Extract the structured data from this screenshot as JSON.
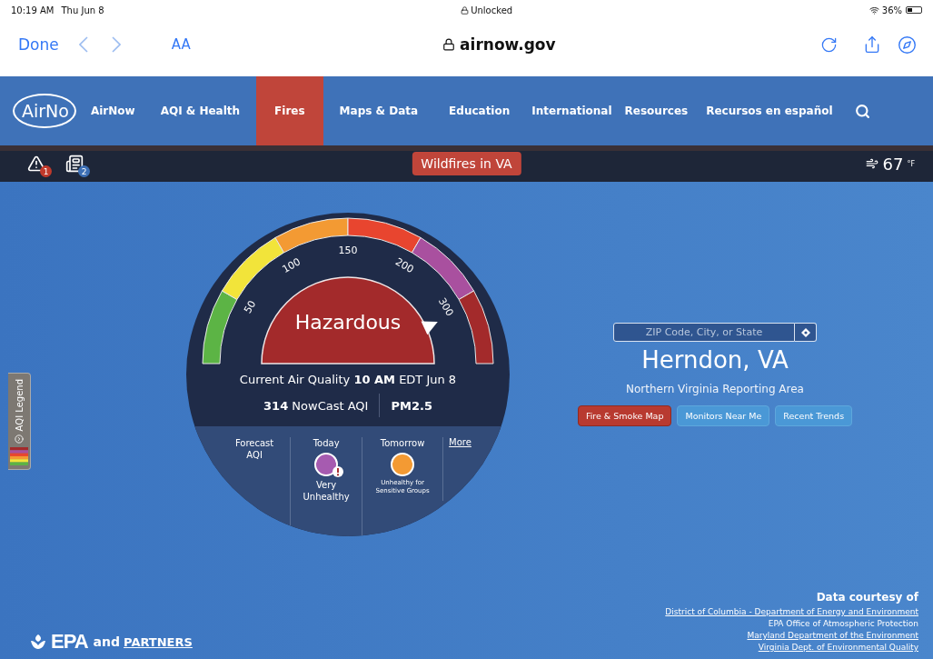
{
  "status_bar": {
    "time": "10:19 AM",
    "date": "Thu Jun 8",
    "lock_label": "Unlocked",
    "battery": "36%"
  },
  "browser": {
    "done": "Done",
    "text_size": "AA",
    "url": "airnow.gov"
  },
  "nav": {
    "logo": "AirNo",
    "items": [
      {
        "label": "AirNow",
        "selected": false
      },
      {
        "label": "AQI & Health",
        "selected": false
      },
      {
        "label": "Fires",
        "selected": true
      },
      {
        "label": "Maps & Data",
        "selected": false
      },
      {
        "label": "Education",
        "selected": false
      },
      {
        "label": "International",
        "selected": false
      },
      {
        "label": "Resources",
        "selected": false
      },
      {
        "label": "Recursos en español",
        "selected": false
      }
    ]
  },
  "alert_bar": {
    "alerts": [
      {
        "kind": "warning",
        "count": "1",
        "color": "#c0392b"
      },
      {
        "kind": "news",
        "count": "2",
        "color": "#3d6fb5"
      }
    ],
    "banner": "Wildfires in VA",
    "temperature": "67",
    "unit": "°F"
  },
  "gauge": {
    "segments": [
      {
        "color": "#5cb445"
      },
      {
        "color": "#f2e43a"
      },
      {
        "color": "#f39a33"
      },
      {
        "color": "#e8452f"
      },
      {
        "color": "#a9509f"
      },
      {
        "color": "#a32a2b"
      }
    ],
    "ticks": [
      "50",
      "100",
      "150",
      "200",
      "300"
    ],
    "category": "Hazardous",
    "current": "Current Air Quality **10 AM** EDT Jun 8",
    "aqi": "**314** NowCast AQI",
    "pollutant": "PM2.5"
  },
  "forecast": {
    "label": "Forecast AQI",
    "days": [
      {
        "day": "Today",
        "color": "#a65bb0",
        "category": "Very Unhealthy",
        "alert": true
      },
      {
        "day": "Tomorrow",
        "color": "#f39a33",
        "category": "Unhealthy for Sensitive Groups",
        "alert": false
      }
    ],
    "more": "More"
  },
  "legend_tab": {
    "label": "AQI Legend"
  },
  "location": {
    "placeholder": "ZIP Code, City, or State",
    "city": "Herndon, VA",
    "area": "Northern Virginia Reporting Area",
    "buttons": [
      {
        "label": "Fire & Smoke Map",
        "selected": true
      },
      {
        "label": "Monitors Near Me",
        "selected": false
      },
      {
        "label": "Recent Trends",
        "selected": false
      }
    ]
  },
  "footer": {
    "epa": "EPA",
    "and": "and",
    "partners": "PARTNERS",
    "courtesy_title": "Data courtesy of",
    "sources": [
      {
        "name": "District of Columbia - Department of Energy and Environment",
        "link": true
      },
      {
        "name": "EPA Office of Atmospheric Protection",
        "link": false
      },
      {
        "name": "Maryland Department of the Environment",
        "link": true
      },
      {
        "name": "Virginia Dept. of Environmental Quality",
        "link": true
      }
    ]
  }
}
